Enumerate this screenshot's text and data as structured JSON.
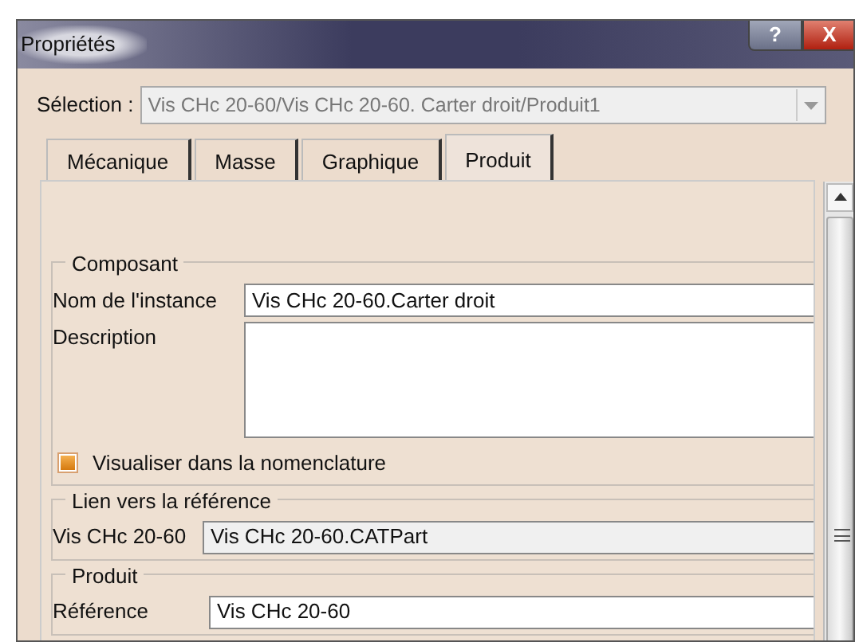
{
  "window": {
    "title": "Propriétés",
    "buttons": [
      "?",
      "X"
    ]
  },
  "selection": {
    "label": "Sélection :",
    "value": "Vis CHc 20-60/Vis CHc 20-60. Carter droit/Produit1",
    "disabled": true
  },
  "tabs": [
    {
      "label": "Mécanique",
      "selected": false
    },
    {
      "label": "Masse",
      "selected": false
    },
    {
      "label": "Graphique",
      "selected": false
    },
    {
      "label": "Produit",
      "selected": true
    }
  ],
  "composant": {
    "title": "Composant",
    "instance_label": "Nom de l'instance",
    "instance_value": "Vis CHc 20-60.Carter droit",
    "description_label": "Description",
    "checkbox": {
      "label": "Visualiser dans la nomenclature",
      "checked": true
    }
  },
  "lien": {
    "title": "Lien vers la référence",
    "label": "Vis CHc 20-60",
    "value": "Vis CHc 20-60.CATPart"
  },
  "produit": {
    "title": "Produit",
    "reference_label": "Référence",
    "reference_value": "Vis CHc 20-60"
  }
}
